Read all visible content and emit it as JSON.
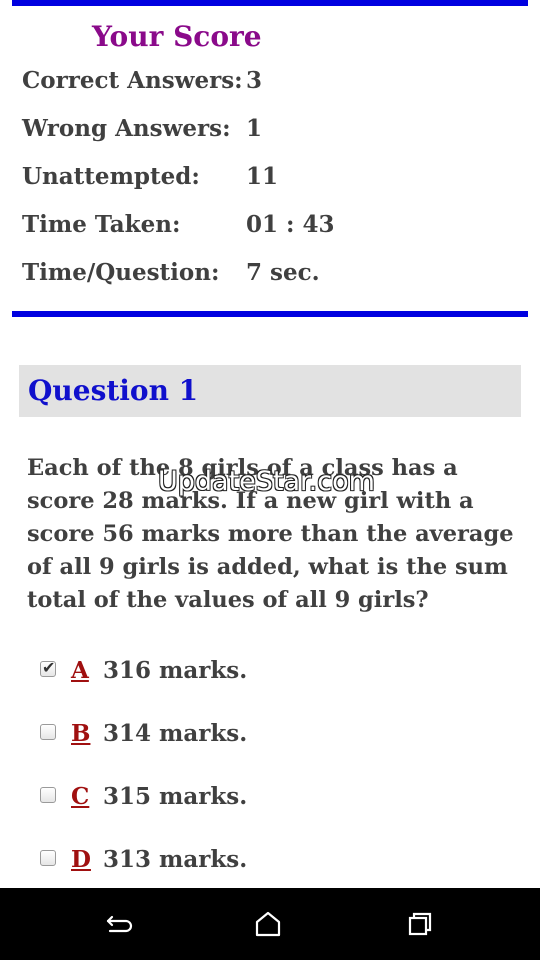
{
  "score": {
    "title": "Your Score",
    "rows": [
      {
        "label": "Correct Answers:",
        "value": "3"
      },
      {
        "label": "Wrong Answers:",
        "value": "1"
      },
      {
        "label": "Unattempted:",
        "value": "11"
      },
      {
        "label": "Time Taken:",
        "value": "01 : 43"
      },
      {
        "label": "Time/Question:",
        "value": "7 sec."
      }
    ]
  },
  "question": {
    "header": "Question 1",
    "text": "Each of the 8 girls of a class has a score 28 marks. If a new girl with a score 56 marks more than the average of all 9 girls is added, what is the sum total of the values of all 9 girls?",
    "options": [
      {
        "letter": "A",
        "text": "316 marks.",
        "checked": true
      },
      {
        "letter": "B",
        "text": "314 marks.",
        "checked": false
      },
      {
        "letter": "C",
        "text": "315 marks.",
        "checked": false
      },
      {
        "letter": "D",
        "text": "313 marks.",
        "checked": false
      }
    ]
  },
  "watermark": "UpdateStar.com",
  "colors": {
    "accent_bar": "#0000e0",
    "score_title": "#8a0a8a",
    "question_header": "#1010cc",
    "option_letter": "#a01010"
  },
  "nav": {
    "back_icon": "back-icon",
    "home_icon": "home-icon",
    "recents_icon": "recents-icon"
  }
}
